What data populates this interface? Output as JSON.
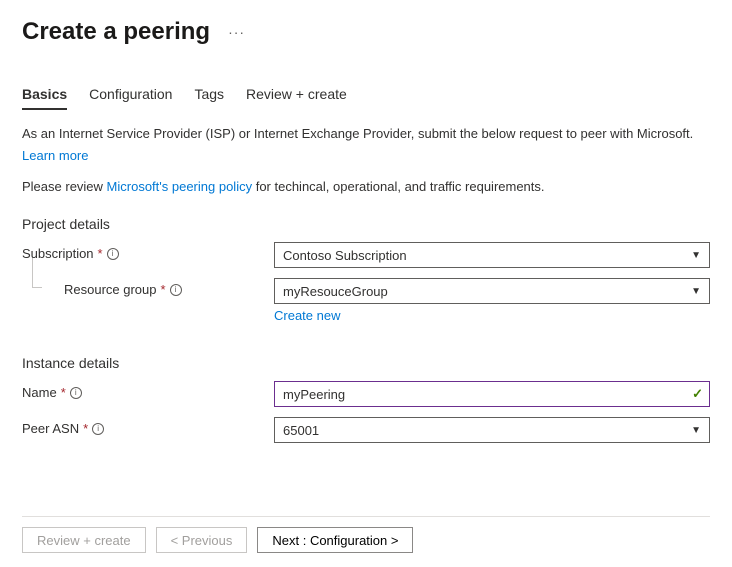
{
  "header": {
    "title": "Create a peering"
  },
  "tabs": {
    "basics": "Basics",
    "configuration": "Configuration",
    "tags": "Tags",
    "review": "Review + create"
  },
  "intro": {
    "line": "As an Internet Service Provider (ISP) or Internet Exchange Provider, submit the below request to peer with Microsoft.",
    "learn_more": "Learn more"
  },
  "policy": {
    "prefix": "Please review ",
    "link": "Microsoft's peering policy",
    "suffix": " for techincal, operational, and traffic requirements."
  },
  "sections": {
    "project": "Project details",
    "instance": "Instance details"
  },
  "fields": {
    "subscription": {
      "label": "Subscription",
      "value": "Contoso Subscription"
    },
    "resource_group": {
      "label": "Resource group",
      "value": "myResouceGroup",
      "create_new": "Create new"
    },
    "name": {
      "label": "Name",
      "value": "myPeering"
    },
    "peer_asn": {
      "label": "Peer ASN",
      "value": "65001"
    }
  },
  "footer": {
    "review": "Review + create",
    "previous": "< Previous",
    "next": "Next : Configuration >"
  }
}
